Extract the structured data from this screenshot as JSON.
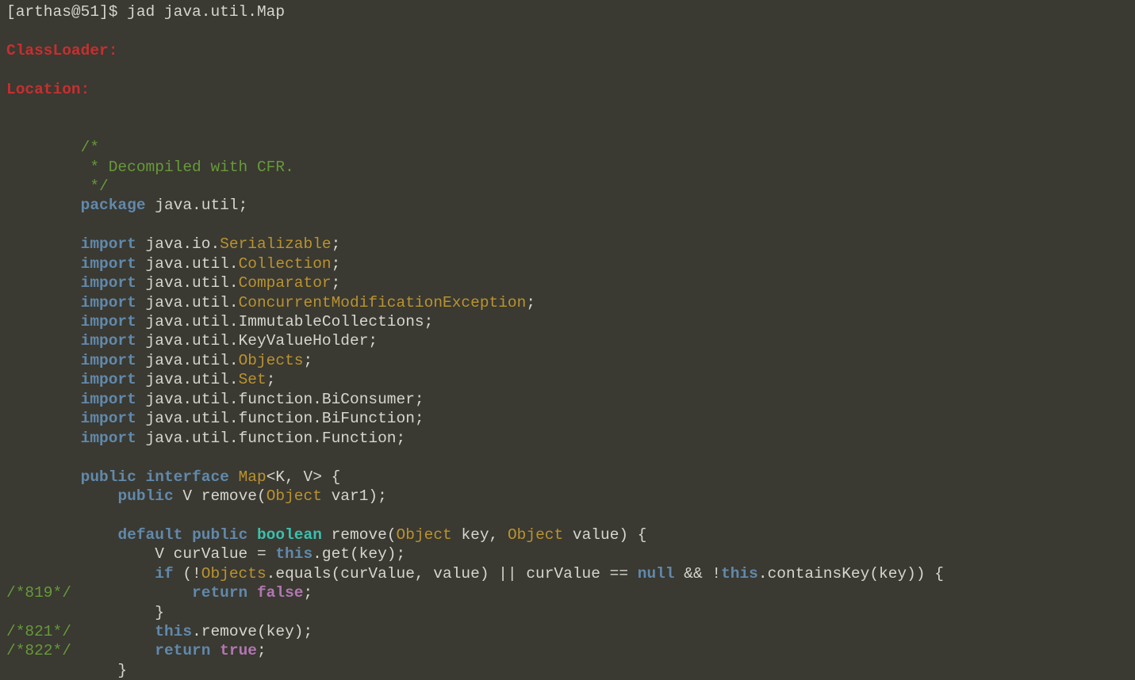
{
  "palette": {
    "background": "#3a3932",
    "default_text": "#d6d6ce",
    "keyword": "#6189ab",
    "class_name": "#ba932f",
    "comment": "#669a38",
    "line_number_comment": "#669a38",
    "section_label": "#c62f2f",
    "primitive_type": "#3ac0ae",
    "boolean_literal": "#b276b2"
  },
  "terminal": {
    "prompt": "[arthas@51]$",
    "command": "jad java.util.Map",
    "lines": [
      {
        "name": "prompt-line",
        "segments": [
          {
            "text": "[arthas@51]$ jad java.util.Map",
            "style": "default"
          }
        ]
      },
      {
        "name": "blank-line",
        "segments": []
      },
      {
        "name": "classloader-label",
        "segments": [
          {
            "text": "ClassLoader:",
            "style": "label"
          }
        ]
      },
      {
        "name": "blank-line",
        "segments": []
      },
      {
        "name": "location-label",
        "segments": [
          {
            "text": "Location:",
            "style": "label"
          }
        ]
      },
      {
        "name": "blank-line",
        "segments": []
      },
      {
        "name": "blank-line",
        "segments": []
      },
      {
        "name": "code-line",
        "segments": [
          {
            "text": "        ",
            "style": "default"
          },
          {
            "text": "/*",
            "style": "comment"
          }
        ]
      },
      {
        "name": "code-line",
        "segments": [
          {
            "text": "        ",
            "style": "default"
          },
          {
            "text": " * Decompiled with CFR.",
            "style": "comment"
          }
        ]
      },
      {
        "name": "code-line",
        "segments": [
          {
            "text": "        ",
            "style": "default"
          },
          {
            "text": " */",
            "style": "comment"
          }
        ]
      },
      {
        "name": "code-line",
        "segments": [
          {
            "text": "        ",
            "style": "default"
          },
          {
            "text": "package",
            "style": "keyword"
          },
          {
            "text": " java.util;",
            "style": "default"
          }
        ]
      },
      {
        "name": "blank-line",
        "segments": []
      },
      {
        "name": "code-line",
        "segments": [
          {
            "text": "        ",
            "style": "default"
          },
          {
            "text": "import",
            "style": "keyword"
          },
          {
            "text": " java.io.",
            "style": "default"
          },
          {
            "text": "Serializable",
            "style": "type"
          },
          {
            "text": ";",
            "style": "default"
          }
        ]
      },
      {
        "name": "code-line",
        "segments": [
          {
            "text": "        ",
            "style": "default"
          },
          {
            "text": "import",
            "style": "keyword"
          },
          {
            "text": " java.util.",
            "style": "default"
          },
          {
            "text": "Collection",
            "style": "type"
          },
          {
            "text": ";",
            "style": "default"
          }
        ]
      },
      {
        "name": "code-line",
        "segments": [
          {
            "text": "        ",
            "style": "default"
          },
          {
            "text": "import",
            "style": "keyword"
          },
          {
            "text": " java.util.",
            "style": "default"
          },
          {
            "text": "Comparator",
            "style": "type"
          },
          {
            "text": ";",
            "style": "default"
          }
        ]
      },
      {
        "name": "code-line",
        "segments": [
          {
            "text": "        ",
            "style": "default"
          },
          {
            "text": "import",
            "style": "keyword"
          },
          {
            "text": " java.util.",
            "style": "default"
          },
          {
            "text": "ConcurrentModificationException",
            "style": "type"
          },
          {
            "text": ";",
            "style": "default"
          }
        ]
      },
      {
        "name": "code-line",
        "segments": [
          {
            "text": "        ",
            "style": "default"
          },
          {
            "text": "import",
            "style": "keyword"
          },
          {
            "text": " java.util.ImmutableCollections;",
            "style": "default"
          }
        ]
      },
      {
        "name": "code-line",
        "segments": [
          {
            "text": "        ",
            "style": "default"
          },
          {
            "text": "import",
            "style": "keyword"
          },
          {
            "text": " java.util.KeyValueHolder;",
            "style": "default"
          }
        ]
      },
      {
        "name": "code-line",
        "segments": [
          {
            "text": "        ",
            "style": "default"
          },
          {
            "text": "import",
            "style": "keyword"
          },
          {
            "text": " java.util.",
            "style": "default"
          },
          {
            "text": "Objects",
            "style": "type"
          },
          {
            "text": ";",
            "style": "default"
          }
        ]
      },
      {
        "name": "code-line",
        "segments": [
          {
            "text": "        ",
            "style": "default"
          },
          {
            "text": "import",
            "style": "keyword"
          },
          {
            "text": " java.util.",
            "style": "default"
          },
          {
            "text": "Set",
            "style": "type"
          },
          {
            "text": ";",
            "style": "default"
          }
        ]
      },
      {
        "name": "code-line",
        "segments": [
          {
            "text": "        ",
            "style": "default"
          },
          {
            "text": "import",
            "style": "keyword"
          },
          {
            "text": " java.util.function.BiConsumer;",
            "style": "default"
          }
        ]
      },
      {
        "name": "code-line",
        "segments": [
          {
            "text": "        ",
            "style": "default"
          },
          {
            "text": "import",
            "style": "keyword"
          },
          {
            "text": " java.util.function.BiFunction;",
            "style": "default"
          }
        ]
      },
      {
        "name": "code-line",
        "segments": [
          {
            "text": "        ",
            "style": "default"
          },
          {
            "text": "import",
            "style": "keyword"
          },
          {
            "text": " java.util.function.Function;",
            "style": "default"
          }
        ]
      },
      {
        "name": "blank-line",
        "segments": []
      },
      {
        "name": "code-line",
        "segments": [
          {
            "text": "        ",
            "style": "default"
          },
          {
            "text": "public",
            "style": "keyword"
          },
          {
            "text": " ",
            "style": "default"
          },
          {
            "text": "interface",
            "style": "keyword"
          },
          {
            "text": " ",
            "style": "default"
          },
          {
            "text": "Map",
            "style": "type"
          },
          {
            "text": "<K, V> {",
            "style": "default"
          }
        ]
      },
      {
        "name": "code-line",
        "segments": [
          {
            "text": "            ",
            "style": "default"
          },
          {
            "text": "public",
            "style": "keyword"
          },
          {
            "text": " V remove(",
            "style": "default"
          },
          {
            "text": "Object",
            "style": "type"
          },
          {
            "text": " var1);",
            "style": "default"
          }
        ]
      },
      {
        "name": "blank-line",
        "segments": []
      },
      {
        "name": "code-line",
        "segments": [
          {
            "text": "            ",
            "style": "default"
          },
          {
            "text": "default",
            "style": "keyword"
          },
          {
            "text": " ",
            "style": "default"
          },
          {
            "text": "public",
            "style": "keyword"
          },
          {
            "text": " ",
            "style": "default"
          },
          {
            "text": "boolean",
            "style": "bool"
          },
          {
            "text": " remove(",
            "style": "default"
          },
          {
            "text": "Object",
            "style": "type"
          },
          {
            "text": " key, ",
            "style": "default"
          },
          {
            "text": "Object",
            "style": "type"
          },
          {
            "text": " value) {",
            "style": "default"
          }
        ]
      },
      {
        "name": "code-line",
        "segments": [
          {
            "text": "                V curValue = ",
            "style": "default"
          },
          {
            "text": "this",
            "style": "keyword"
          },
          {
            "text": ".get(key);",
            "style": "default"
          }
        ]
      },
      {
        "name": "code-line",
        "segments": [
          {
            "text": "                ",
            "style": "default"
          },
          {
            "text": "if",
            "style": "keyword"
          },
          {
            "text": " (!",
            "style": "default"
          },
          {
            "text": "Objects",
            "style": "type"
          },
          {
            "text": ".equals(curValue, value) || curValue == ",
            "style": "default"
          },
          {
            "text": "null",
            "style": "keyword"
          },
          {
            "text": " && !",
            "style": "default"
          },
          {
            "text": "this",
            "style": "keyword"
          },
          {
            "text": ".containsKey(key)) {",
            "style": "default"
          }
        ]
      },
      {
        "name": "code-line",
        "segments": [
          {
            "text": "/*819*/",
            "style": "lineno"
          },
          {
            "text": "             ",
            "style": "default"
          },
          {
            "text": "return",
            "style": "keyword"
          },
          {
            "text": " ",
            "style": "default"
          },
          {
            "text": "false",
            "style": "lit"
          },
          {
            "text": ";",
            "style": "default"
          }
        ]
      },
      {
        "name": "code-line",
        "segments": [
          {
            "text": "                }",
            "style": "default"
          }
        ]
      },
      {
        "name": "code-line",
        "segments": [
          {
            "text": "/*821*/",
            "style": "lineno"
          },
          {
            "text": "         ",
            "style": "default"
          },
          {
            "text": "this",
            "style": "keyword"
          },
          {
            "text": ".remove(key);",
            "style": "default"
          }
        ]
      },
      {
        "name": "code-line",
        "segments": [
          {
            "text": "/*822*/",
            "style": "lineno"
          },
          {
            "text": "         ",
            "style": "default"
          },
          {
            "text": "return",
            "style": "keyword"
          },
          {
            "text": " ",
            "style": "default"
          },
          {
            "text": "true",
            "style": "lit"
          },
          {
            "text": ";",
            "style": "default"
          }
        ]
      },
      {
        "name": "code-line",
        "segments": [
          {
            "text": "            }",
            "style": "default"
          }
        ]
      }
    ]
  }
}
